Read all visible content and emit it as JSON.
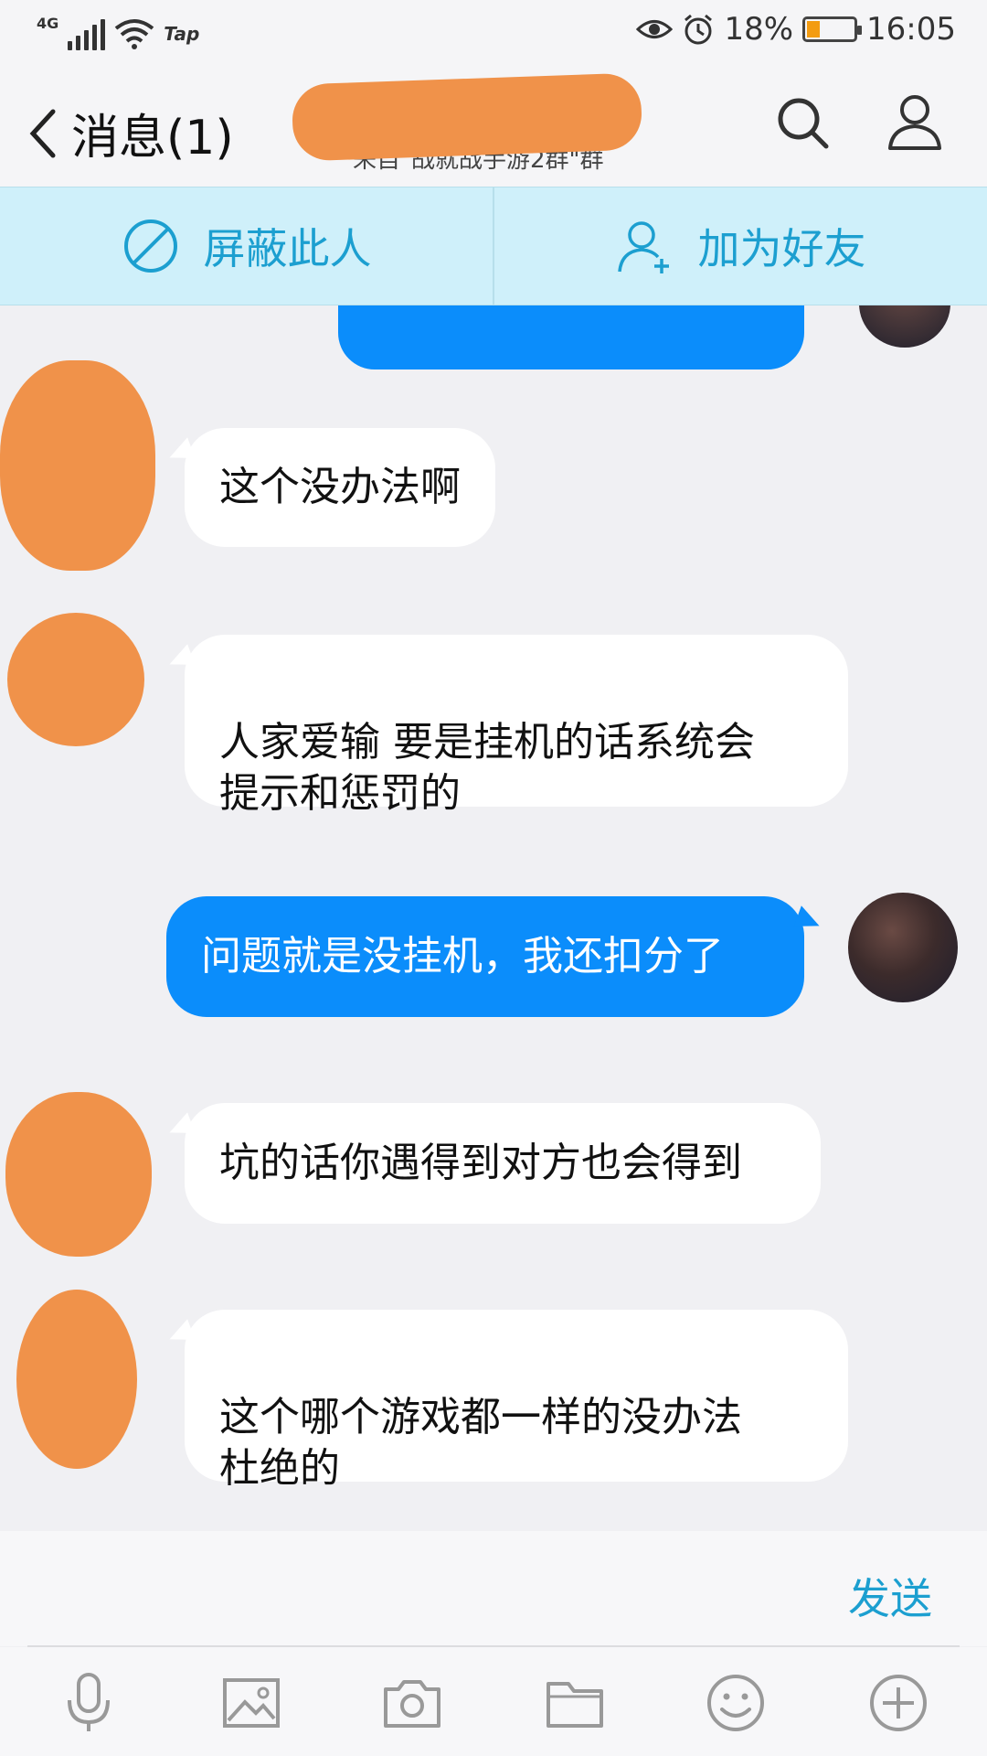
{
  "status_bar": {
    "network": "4G",
    "carrier_app": "Tap",
    "battery_percent": "18%",
    "time": "16:05"
  },
  "header": {
    "title": "消息(1)",
    "subtitle": "来自\"战就战手游2群\"群"
  },
  "actions": {
    "block_label": "屏蔽此人",
    "add_friend_label": "加为好友"
  },
  "messages": [
    {
      "side": "in",
      "text": "这个没办法啊"
    },
    {
      "side": "in",
      "text": "人家爱输 要是挂机的话系统会\n提示和惩罚的"
    },
    {
      "side": "out",
      "text": "问题就是没挂机，我还扣分了"
    },
    {
      "side": "in",
      "text": "坑的话你遇得到对方也会得到"
    },
    {
      "side": "in",
      "text": "这个哪个游戏都一样的没办法\n杜绝的"
    }
  ],
  "input": {
    "send_label": "发送"
  },
  "toolbar": {
    "icons": [
      "microphone-icon",
      "image-icon",
      "camera-icon",
      "folder-icon",
      "emoji-icon",
      "plus-icon"
    ]
  },
  "colors": {
    "accent": "#1c9fd0",
    "outgoing_bubble": "#0b8dfb",
    "redaction": "#f0924a"
  }
}
